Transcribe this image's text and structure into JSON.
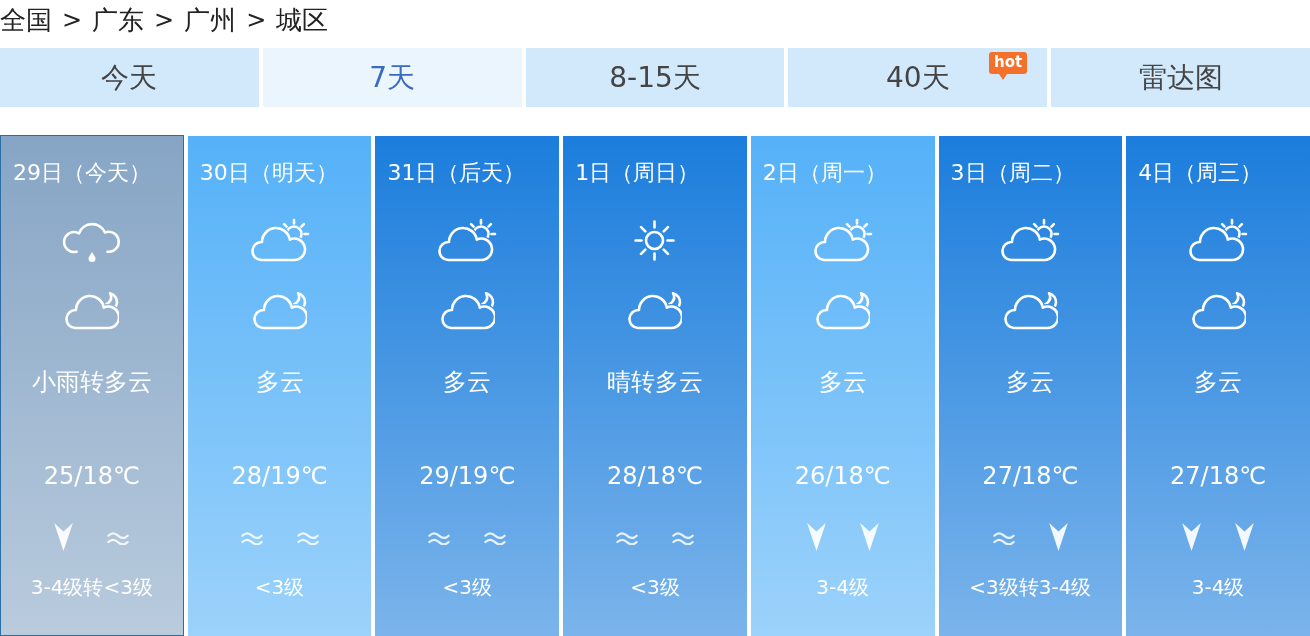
{
  "breadcrumb": {
    "items": [
      "全国",
      "广东",
      "广州",
      "城区"
    ],
    "separators": [
      ">",
      ">",
      ">"
    ]
  },
  "tabs": [
    {
      "label": "今天",
      "selected": false
    },
    {
      "label": "7天",
      "selected": true
    },
    {
      "label": "8-15天",
      "selected": false
    },
    {
      "label": "40天",
      "selected": false,
      "badge": "hot"
    },
    {
      "label": "雷达图",
      "selected": false
    }
  ],
  "days": [
    {
      "date": "29日（今天）",
      "selected": true,
      "color": "#86a5c5",
      "day_icon": {
        "kind": "rain"
      },
      "night_icon": {
        "kind": "cloud-moon"
      },
      "weather": "小雨转多云",
      "temperature": "25/18℃",
      "wind_icons": [
        {
          "kind": "arrow"
        },
        {
          "kind": "waves"
        }
      ],
      "wind": "3-4级转<3级"
    },
    {
      "date": "30日（明天）",
      "selected": false,
      "color": "#55b1f8",
      "day_icon": {
        "kind": "cloud-sun"
      },
      "night_icon": {
        "kind": "cloud-moon"
      },
      "weather": "多云",
      "temperature": "28/19℃",
      "wind_icons": [
        {
          "kind": "waves"
        },
        {
          "kind": "waves"
        }
      ],
      "wind": "<3级"
    },
    {
      "date": "31日（后天）",
      "selected": false,
      "color": "#1b7ddc",
      "day_icon": {
        "kind": "cloud-sun"
      },
      "night_icon": {
        "kind": "cloud-moon"
      },
      "weather": "多云",
      "temperature": "29/19℃",
      "wind_icons": [
        {
          "kind": "waves"
        },
        {
          "kind": "waves"
        }
      ],
      "wind": "<3级"
    },
    {
      "date": "1日（周日）",
      "selected": false,
      "color": "#1b7ddc",
      "day_icon": {
        "kind": "sun"
      },
      "night_icon": {
        "kind": "cloud-moon"
      },
      "weather": "晴转多云",
      "temperature": "28/18℃",
      "wind_icons": [
        {
          "kind": "waves"
        },
        {
          "kind": "waves"
        }
      ],
      "wind": "<3级"
    },
    {
      "date": "2日（周一）",
      "selected": false,
      "color": "#55b1f8",
      "day_icon": {
        "kind": "cloud-sun"
      },
      "night_icon": {
        "kind": "cloud-moon"
      },
      "weather": "多云",
      "temperature": "26/18℃",
      "wind_icons": [
        {
          "kind": "arrow"
        },
        {
          "kind": "arrow"
        }
      ],
      "wind": "3-4级"
    },
    {
      "date": "3日（周二）",
      "selected": false,
      "color": "#1b7ddc",
      "day_icon": {
        "kind": "cloud-sun"
      },
      "night_icon": {
        "kind": "cloud-moon"
      },
      "weather": "多云",
      "temperature": "27/18℃",
      "wind_icons": [
        {
          "kind": "waves"
        },
        {
          "kind": "arrow"
        }
      ],
      "wind": "<3级转3-4级"
    },
    {
      "date": "4日（周三）",
      "selected": false,
      "color": "#1b7ddc",
      "day_icon": {
        "kind": "cloud-sun"
      },
      "night_icon": {
        "kind": "cloud-moon"
      },
      "weather": "多云",
      "temperature": "27/18℃",
      "wind_icons": [
        {
          "kind": "arrow"
        },
        {
          "kind": "arrow"
        }
      ],
      "wind": "3-4级"
    }
  ]
}
